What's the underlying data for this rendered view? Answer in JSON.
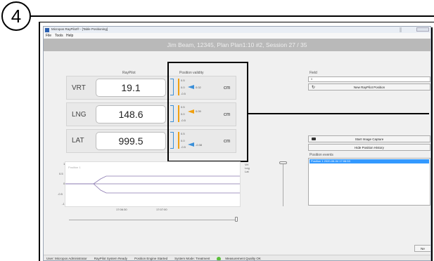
{
  "step_number": "4",
  "window": {
    "title": "Micropos RayPilot® - [Table Positioning]",
    "icon": "app-icon"
  },
  "menu": [
    "File",
    "Tools",
    "Help"
  ],
  "header_text": "Jim Beam, 12345, Plan Plan1:10 #2, Session 27 / 35",
  "raypilot_label": "RayPilot",
  "validity_label": "Position validity",
  "axes": [
    {
      "name": "VRT",
      "value": "19.1",
      "unit": "cm",
      "indicator": "0.02",
      "ticks": [
        "0.5",
        "0.0",
        "-0.5"
      ]
    },
    {
      "name": "LNG",
      "value": "148.6",
      "unit": "cm",
      "indicator": "0.09",
      "ticks": [
        "0.5",
        "0.0",
        "-0.5"
      ]
    },
    {
      "name": "LAT",
      "value": "999.5",
      "unit": "cm",
      "indicator": "-0.38",
      "ticks": [
        "0.5",
        "0.0",
        "-0.5"
      ]
    }
  ],
  "field": {
    "label": "Field",
    "value": "0",
    "new_position_button": "New RayPilot Position"
  },
  "buttons": {
    "start_capture": "Start Image Capture",
    "hide_history": "Hide Position History",
    "next": "Ne"
  },
  "position_events": {
    "label": "Position events",
    "items": [
      "Position 1 2020-06-04 17:06:53"
    ]
  },
  "graph": {
    "title": "Position 1",
    "y_ticks": [
      "1",
      "0.5",
      "0",
      "-0.5",
      "-1"
    ],
    "x_ticks": [
      "17:06:30",
      "17:07:00"
    ],
    "legend": [
      "Vrt",
      "Lng",
      "Lat"
    ]
  },
  "colors": {
    "indicator_orange": "#f0a010",
    "indicator_blue": "#3a8fd8",
    "selection_blue": "#3399ff",
    "graph_line": "#8a78b0",
    "header_bg": "#b9b9b9",
    "quality_ok": "#5cbf3a"
  },
  "statusbar": {
    "user": "User: Micropos Administrator",
    "system": "RayPilot System Ready",
    "engine": "Position Engine Started",
    "mode": "System Mode: Treatment",
    "quality": "Measurement Quality OK"
  }
}
